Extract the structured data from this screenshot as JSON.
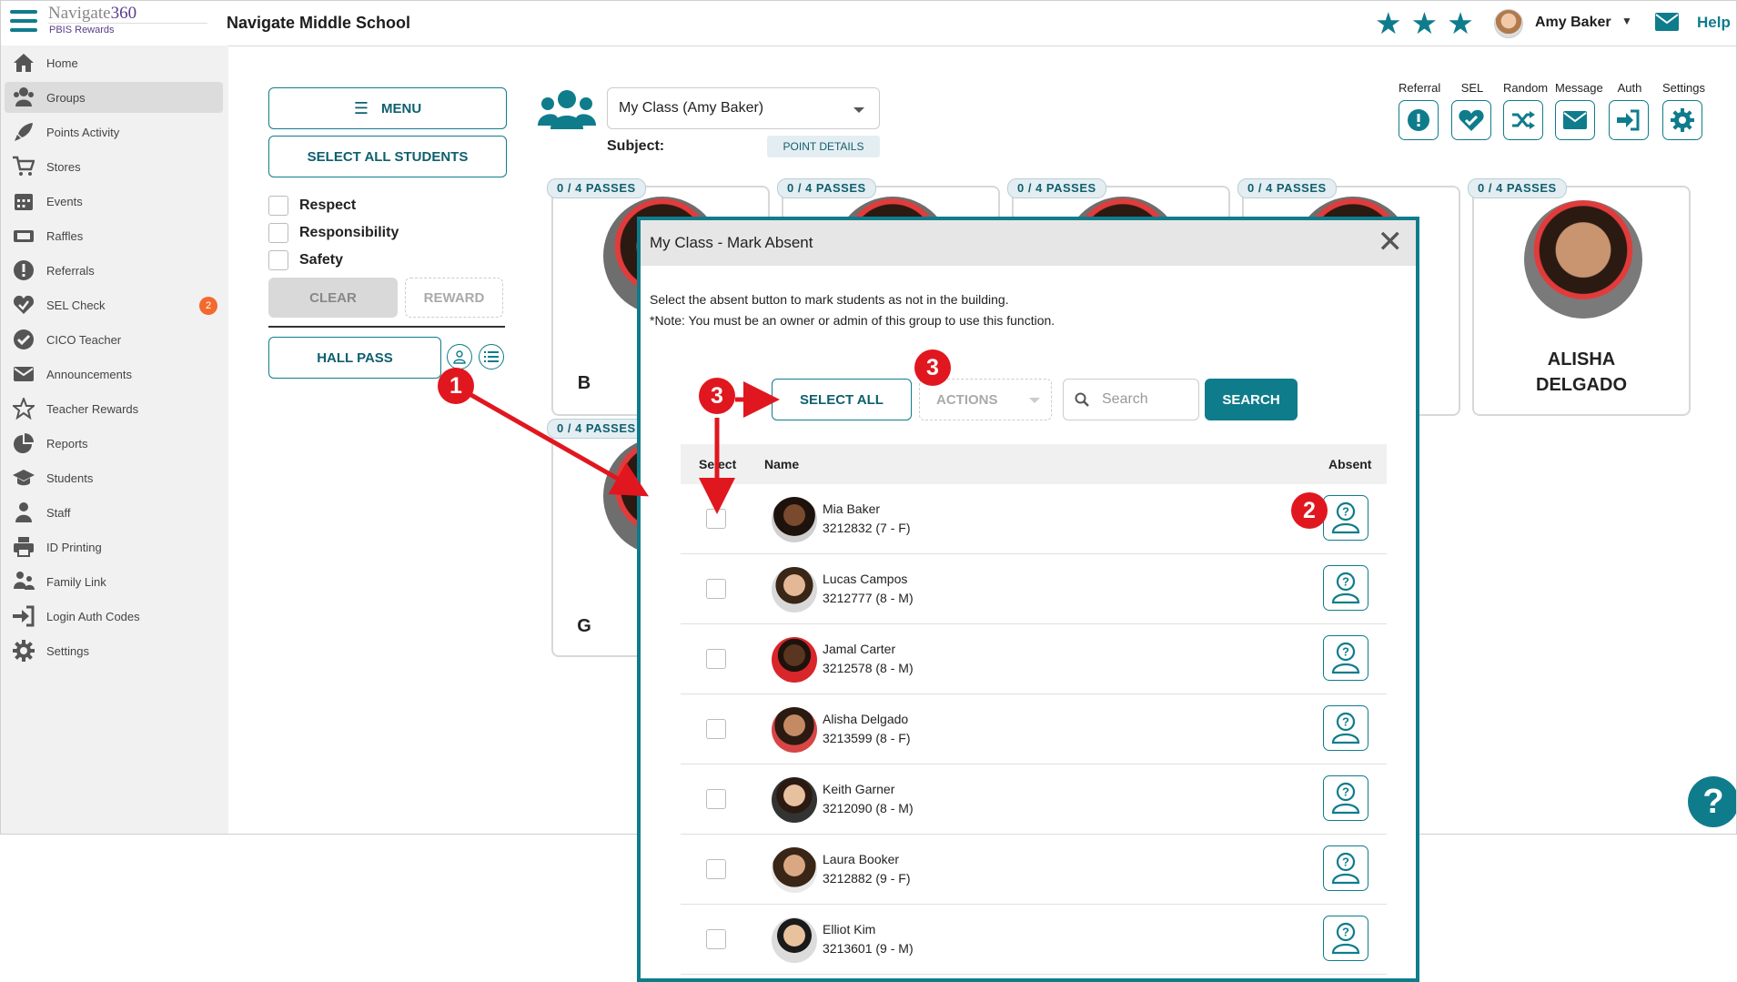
{
  "app": {
    "logo_name": "Navigate",
    "logo_num": "360",
    "logo_sub": "PBIS Rewards",
    "school": "Navigate Middle School"
  },
  "header": {
    "user_name": "Amy Baker",
    "help": "Help",
    "accent_color": "#0f7c8c"
  },
  "sidebar": {
    "items": [
      {
        "label": "Home",
        "icon": "home-icon"
      },
      {
        "label": "Groups",
        "icon": "users-icon"
      },
      {
        "label": "Points Activity",
        "icon": "rocket-icon"
      },
      {
        "label": "Stores",
        "icon": "cart-icon"
      },
      {
        "label": "Events",
        "icon": "calendar-icon"
      },
      {
        "label": "Raffles",
        "icon": "ticket-icon"
      },
      {
        "label": "Referrals",
        "icon": "alert-icon"
      },
      {
        "label": "SEL Check",
        "icon": "heart-check-icon",
        "badge": "2"
      },
      {
        "label": "CICO Teacher",
        "icon": "check-circle-icon"
      },
      {
        "label": "Announcements",
        "icon": "envelope-icon"
      },
      {
        "label": "Teacher Rewards",
        "icon": "star-icon"
      },
      {
        "label": "Reports",
        "icon": "pie-chart-icon"
      },
      {
        "label": "Students",
        "icon": "graduation-cap-icon"
      },
      {
        "label": "Staff",
        "icon": "person-icon"
      },
      {
        "label": "ID Printing",
        "icon": "printer-icon"
      },
      {
        "label": "Family Link",
        "icon": "family-icon"
      },
      {
        "label": "Login Auth Codes",
        "icon": "sign-in-icon"
      },
      {
        "label": "Settings",
        "icon": "gear-icon"
      }
    ]
  },
  "controls": {
    "menu": "MENU",
    "select_all_students": "SELECT ALL STUDENTS",
    "behaviors": [
      "Respect",
      "Responsibility",
      "Safety"
    ],
    "clear": "CLEAR",
    "reward": "REWARD",
    "hall_pass": "HALL PASS"
  },
  "group": {
    "selected": "My Class (Amy Baker)",
    "subject_label": "Subject:",
    "point_details": "POINT DETAILS"
  },
  "toolbar": {
    "referral": "Referral",
    "sel": "SEL",
    "random": "Random",
    "message": "Message",
    "auth": "Auth",
    "settings": "Settings"
  },
  "cards": {
    "pass_text": "0 / 4 PASSES",
    "alisha_first": "ALISHA",
    "alisha_last": "DELGADO",
    "partial_b": "B",
    "partial_g": "G"
  },
  "modal": {
    "title": "My Class - Mark Absent",
    "instruction": "Select the absent button to mark students as not in the building.",
    "note": "*Note: You must be an owner or admin of this group to use this function.",
    "select_all": "SELECT ALL",
    "actions": "ACTIONS",
    "search_placeholder": "Search",
    "search_button": "SEARCH",
    "col_select": "Select",
    "col_name": "Name",
    "col_absent": "Absent",
    "students": [
      {
        "name": "Mia Baker",
        "id": "3212832 (7 - F)"
      },
      {
        "name": "Lucas Campos",
        "id": "3212777 (8 - M)"
      },
      {
        "name": "Jamal Carter",
        "id": "3212578 (8 - M)"
      },
      {
        "name": "Alisha Delgado",
        "id": "3213599 (8 - F)"
      },
      {
        "name": "Keith Garner",
        "id": "3212090 (8 - M)"
      },
      {
        "name": "Laura Booker",
        "id": "3212882 (9 - F)"
      },
      {
        "name": "Elliot Kim",
        "id": "3213601 (9 - M)"
      }
    ]
  },
  "annotations": {
    "marker_1": "1",
    "marker_2": "2",
    "marker_3": "3",
    "color": "#e0171f"
  },
  "help_button": "?"
}
